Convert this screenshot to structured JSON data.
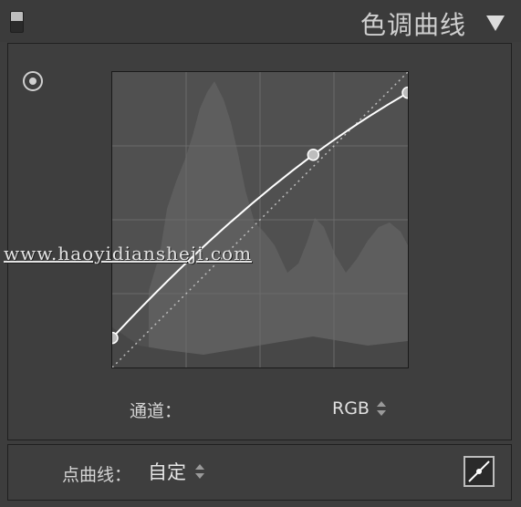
{
  "header": {
    "title": "色调曲线",
    "collapse_icon": "triangle-down-icon",
    "toggle_icon": "panel-toggle-icon"
  },
  "graph": {
    "target_icon": "target-adjustment-icon",
    "curve_points": [
      {
        "input": 0.0,
        "output": 0.1
      },
      {
        "input": 0.68,
        "output": 0.72
      },
      {
        "input": 1.0,
        "output": 0.93
      }
    ]
  },
  "watermark": "www.haoyidiansheji.com",
  "channel": {
    "label": "通道：",
    "value": "RGB"
  },
  "point_curve": {
    "label": "点曲线：",
    "value": "自定"
  },
  "colors": {
    "panel_bg": "#3d3d3d",
    "graph_bg": "#505050",
    "curve": "#ffffff"
  }
}
